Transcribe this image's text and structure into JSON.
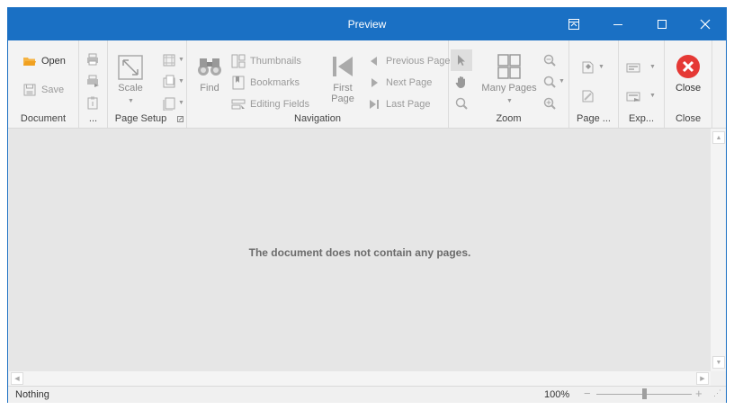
{
  "window": {
    "title": "Preview"
  },
  "titlebar": {
    "buttons": [
      {
        "name": "restore-ribbon-button",
        "icon": "ribbon-display-icon"
      },
      {
        "name": "minimize-button",
        "icon": "minimize-icon"
      },
      {
        "name": "maximize-button",
        "icon": "maximize-icon"
      },
      {
        "name": "close-window-button",
        "icon": "close-icon"
      }
    ]
  },
  "ribbon": {
    "document": {
      "label": "Document",
      "open": "Open",
      "save": "Save"
    },
    "print": {
      "label": "..."
    },
    "page_setup": {
      "label": "Page Setup",
      "scale": "Scale"
    },
    "navigation": {
      "label": "Navigation",
      "find": "Find",
      "thumbnails": "Thumbnails",
      "bookmarks": "Bookmarks",
      "editing_fields": "Editing Fields",
      "first_page": "First Page",
      "previous_page": "Previous Page",
      "next_page": "Next Page",
      "last_page": "Last Page"
    },
    "zoom": {
      "label": "Zoom",
      "many_pages": "Many Pages"
    },
    "page_bg": {
      "label": "Page ..."
    },
    "export": {
      "label": "Exp..."
    },
    "close": {
      "label": "Close",
      "close": "Close"
    }
  },
  "content": {
    "message": "The document does not contain any pages."
  },
  "status": {
    "text": "Nothing",
    "zoom": "100%",
    "zoom_level": 0.5
  },
  "colors": {
    "titlebar": "#1a70c4",
    "accent": "#e53935",
    "open_icon": "#f0a020"
  }
}
